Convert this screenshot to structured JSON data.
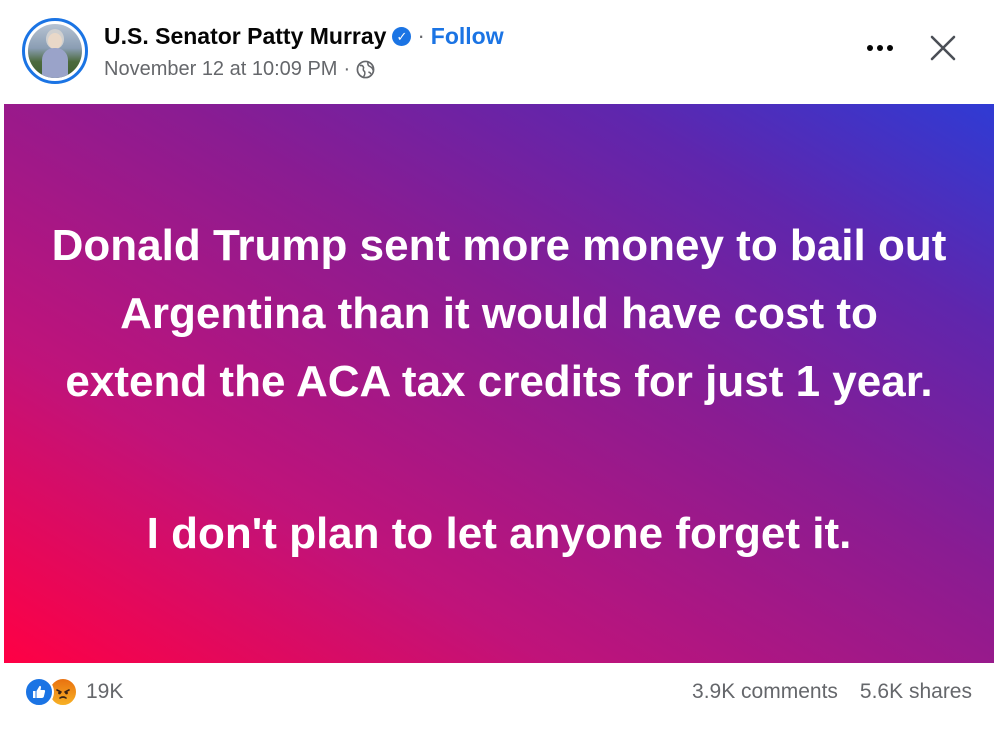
{
  "post": {
    "author": "U.S. Senator Patty Murray",
    "separator": "·",
    "follow_label": "Follow",
    "timestamp": "November 12 at 10:09 PM",
    "meta_separator": "·",
    "audience_icon": "globe-icon",
    "verified_icon": "verified-badge-icon",
    "verified_glyph": "✓",
    "more_icon": "more-options-icon",
    "close_icon": "close-icon"
  },
  "image": {
    "line1": "Donald Trump sent more money to bail out Argentina than it would have cost to extend the ACA tax credits for just 1 year.",
    "line2": "I don't plan to let anyone forget it.",
    "gradient_colors": [
      "#ff0044",
      "#c0137a",
      "#8a1c92",
      "#5f26ad",
      "#2f3bd4"
    ]
  },
  "engagement": {
    "reaction_icons": [
      "like-icon",
      "angry-icon"
    ],
    "reaction_count": "19K",
    "comments": "3.9K comments",
    "shares": "5.6K shares"
  },
  "colors": {
    "brand_blue": "#1b74e4",
    "secondary_text": "#65676b",
    "primary_text": "#050505"
  }
}
